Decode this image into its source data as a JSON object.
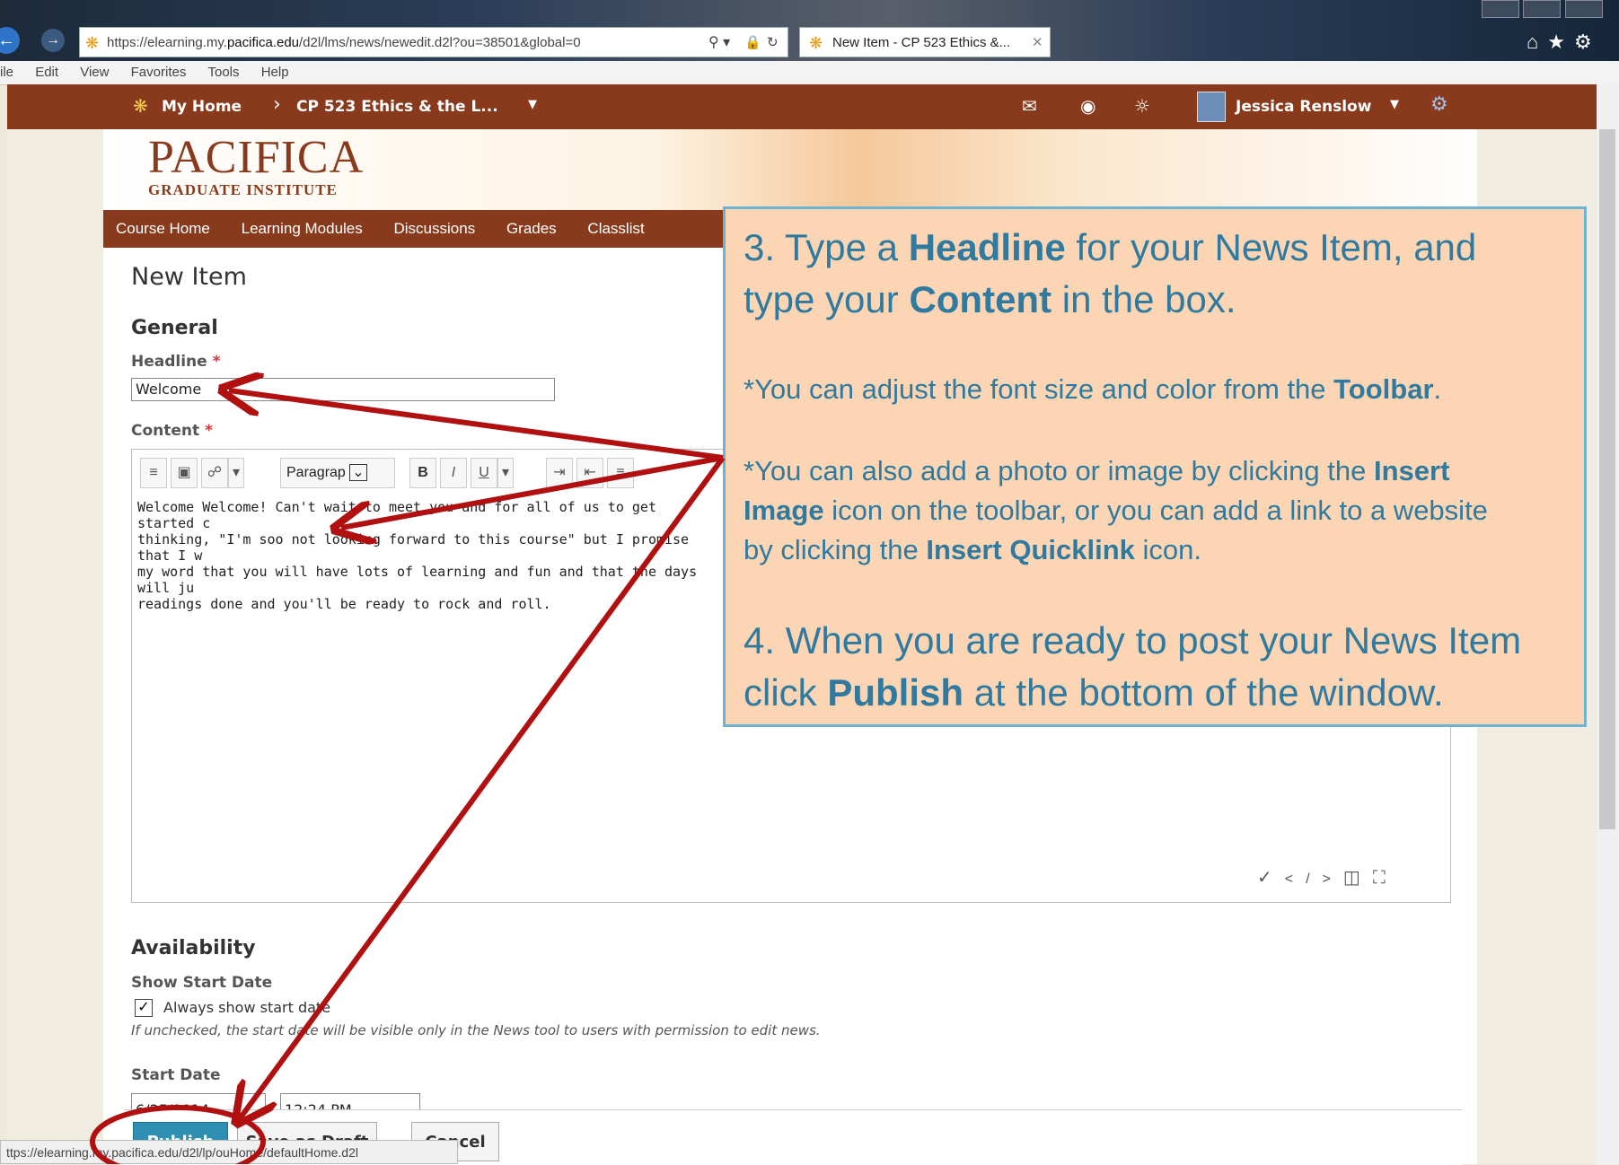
{
  "browser": {
    "url_prefix": "https://elearning.my.",
    "url_domain": "pacifica.edu",
    "url_path": "/d2l/lms/news/newedit.d2l?ou=38501&global=0",
    "tab_title": "New Item - CP 523 Ethics &...",
    "menu": [
      "ile",
      "Edit",
      "View",
      "Favorites",
      "Tools",
      "Help"
    ],
    "status_url": "ttps://elearning.my.pacifica.edu/d2l/lp/ouHome/defaultHome.d2l"
  },
  "topbar": {
    "home": "My Home",
    "course": "CP 523 Ethics & the L...",
    "user": "Jessica Renslow"
  },
  "logo": {
    "line1": "PACIFICA",
    "line2": "GRADUATE INSTITUTE"
  },
  "coursenav": [
    "Course Home",
    "Learning Modules",
    "Discussions",
    "Grades",
    "Classlist"
  ],
  "form": {
    "title": "New Item",
    "general": "General",
    "headline_label": "Headline",
    "headline_value": "Welcome",
    "content_label": "Content",
    "paragraph": "Paragrap",
    "content_lines": [
      "Welcome Welcome! Can't wait to meet you and for all of us to get started c",
      "thinking, \"I'm soo not looking forward to this course\" but I promise that I w",
      "my word that you will have lots of learning and fun and that the days will ju",
      "readings done and you'll be ready to rock and roll."
    ],
    "availability": "Availability",
    "show_start_date": "Show Start Date",
    "always_show": "Always show start date",
    "note": "If unchecked, the start date will be visible only in the News tool to users with permission to edit news.",
    "start_date_label": "Start Date",
    "start_date": "6/25/2014",
    "start_time": "12:24 PM",
    "publish": "Publish",
    "save_draft": "Save as Draft",
    "cancel": "Cancel"
  },
  "callout": {
    "p1_a": "3. Type a ",
    "p1_b": "Headline",
    "p1_c": " for your News Item, and",
    "p1_d": "type your ",
    "p1_e": "Content",
    "p1_f": " in the box.",
    "p2_a": "*You can adjust the font size and color from the ",
    "p2_b": "Toolbar",
    "p2_c": ".",
    "p3_a": "*You can also add a photo or image by clicking the ",
    "p3_b": "Insert",
    "p3_c": "Image",
    "p3_d": " icon on the toolbar, or you can add a link to a website",
    "p3_e": "by clicking the ",
    "p3_f": "Insert Quicklink",
    "p3_g": " icon.",
    "p4_a": "4. When you are ready to post your News Item",
    "p4_b": "click ",
    "p4_c": "Publish",
    "p4_d": " at the bottom of the window."
  },
  "colors": {
    "accent": "#8a3a1c",
    "callout_bg": "#fcd5b4",
    "callout_text": "#2f7a9e",
    "arrow": "#b01010",
    "publish": "#2f8fb3"
  }
}
